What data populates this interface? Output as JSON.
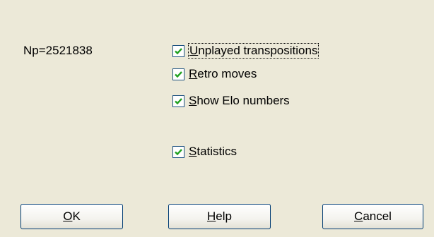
{
  "info": {
    "np_text": "Np=2521838"
  },
  "options": [
    {
      "accel": "U",
      "rest": "nplayed transpositions",
      "checked": true,
      "focused": true
    },
    {
      "accel": "R",
      "rest": "etro moves",
      "checked": true,
      "focused": false
    },
    {
      "accel": "S",
      "rest": "how Elo numbers",
      "checked": true,
      "focused": false
    },
    {
      "accel": "S",
      "rest": "tatistics",
      "checked": true,
      "focused": false
    }
  ],
  "buttons": {
    "ok": {
      "accel": "O",
      "rest": "K"
    },
    "help": {
      "accel": "H",
      "rest": "elp"
    },
    "cancel": {
      "accel": "C",
      "rest": "ancel"
    }
  },
  "colors": {
    "dialog_bg": "#ece9d8",
    "checkmark": "#21a121",
    "checkbox_border": "#1c5180",
    "button_border": "#003c74"
  }
}
